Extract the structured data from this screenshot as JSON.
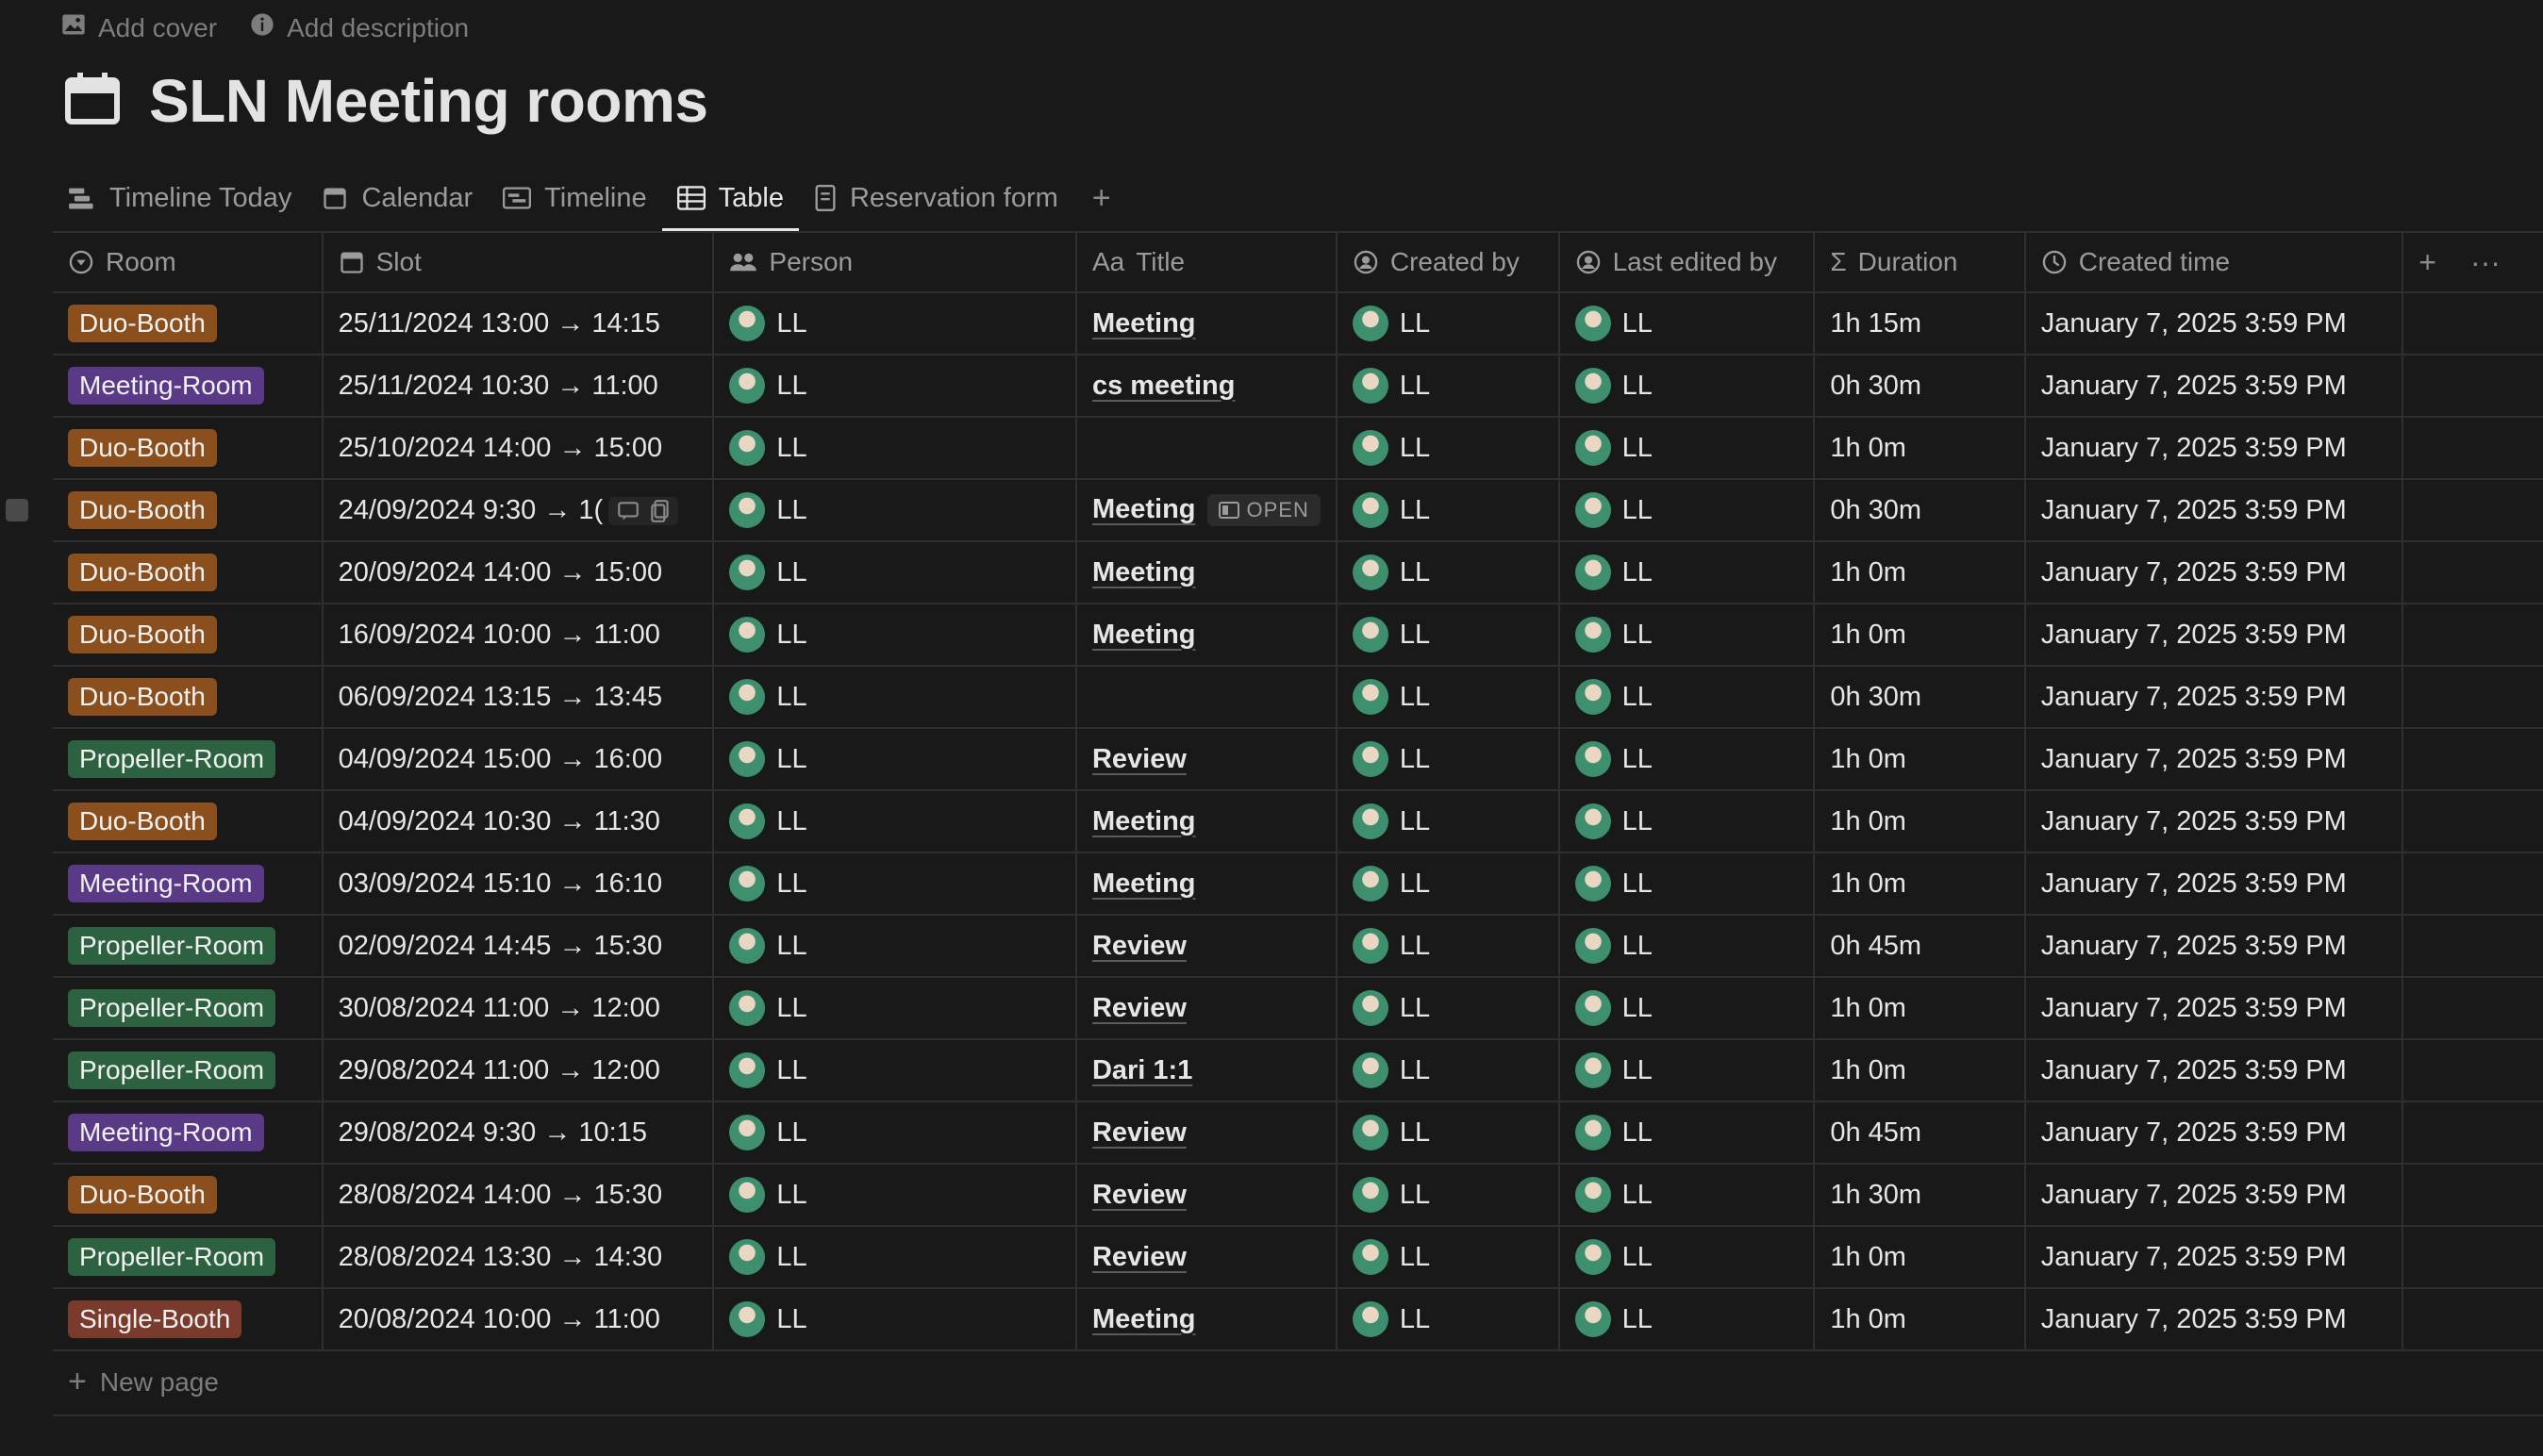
{
  "top_actions": {
    "add_cover": "Add cover",
    "add_description": "Add description"
  },
  "page_title": "SLN Meeting rooms",
  "tabs": [
    {
      "label": "Timeline Today",
      "icon": "timeline-today-icon",
      "active": false
    },
    {
      "label": "Calendar",
      "icon": "calendar-icon",
      "active": false
    },
    {
      "label": "Timeline",
      "icon": "timeline-icon",
      "active": false
    },
    {
      "label": "Table",
      "icon": "table-icon",
      "active": true
    },
    {
      "label": "Reservation form",
      "icon": "form-icon",
      "active": false
    }
  ],
  "columns": {
    "room": "Room",
    "slot": "Slot",
    "person": "Person",
    "title": "Title",
    "created_by": "Created by",
    "last_edited_by": "Last edited by",
    "duration": "Duration",
    "created_time": "Created time",
    "title_prefix": "Aa"
  },
  "room_colors": {
    "Duo-Booth": "#8a4f1c",
    "Meeting-Room": "#5a3a87",
    "Propeller-Room": "#2d6240",
    "Single-Booth": "#7a3a2c"
  },
  "rows": [
    {
      "room": "Duo-Booth",
      "slot": "25/11/2024 13:00 → 14:15",
      "person": "LL",
      "title": "Meeting",
      "created_by": "LL",
      "last_edited_by": "LL",
      "duration": "1h 15m",
      "created_time": "January 7, 2025 3:59 PM"
    },
    {
      "room": "Meeting-Room",
      "slot": "25/11/2024 10:30 → 11:00",
      "person": "LL",
      "title": "cs meeting",
      "created_by": "LL",
      "last_edited_by": "LL",
      "duration": "0h 30m",
      "created_time": "January 7, 2025 3:59 PM"
    },
    {
      "room": "Duo-Booth",
      "slot": "25/10/2024 14:00 → 15:00",
      "person": "LL",
      "title": "",
      "created_by": "LL",
      "last_edited_by": "LL",
      "duration": "1h 0m",
      "created_time": "January 7, 2025 3:59 PM"
    },
    {
      "room": "Duo-Booth",
      "slot": "24/09/2024 9:30 → 1(",
      "person": "LL",
      "title": "Meeting",
      "created_by": "LL",
      "last_edited_by": "LL",
      "duration": "0h 30m",
      "created_time": "January 7, 2025 3:59 PM",
      "hover": true,
      "open_label": "OPEN"
    },
    {
      "room": "Duo-Booth",
      "slot": "20/09/2024 14:00 → 15:00",
      "person": "LL",
      "title": "Meeting",
      "created_by": "LL",
      "last_edited_by": "LL",
      "duration": "1h 0m",
      "created_time": "January 7, 2025 3:59 PM"
    },
    {
      "room": "Duo-Booth",
      "slot": "16/09/2024 10:00 → 11:00",
      "person": "LL",
      "title": "Meeting",
      "created_by": "LL",
      "last_edited_by": "LL",
      "duration": "1h 0m",
      "created_time": "January 7, 2025 3:59 PM"
    },
    {
      "room": "Duo-Booth",
      "slot": "06/09/2024 13:15 → 13:45",
      "person": "LL",
      "title": "",
      "created_by": "LL",
      "last_edited_by": "LL",
      "duration": "0h 30m",
      "created_time": "January 7, 2025 3:59 PM"
    },
    {
      "room": "Propeller-Room",
      "slot": "04/09/2024 15:00 → 16:00",
      "person": "LL",
      "title": "Review",
      "created_by": "LL",
      "last_edited_by": "LL",
      "duration": "1h 0m",
      "created_time": "January 7, 2025 3:59 PM"
    },
    {
      "room": "Duo-Booth",
      "slot": "04/09/2024 10:30 → 11:30",
      "person": "LL",
      "title": "Meeting",
      "created_by": "LL",
      "last_edited_by": "LL",
      "duration": "1h 0m",
      "created_time": "January 7, 2025 3:59 PM"
    },
    {
      "room": "Meeting-Room",
      "slot": "03/09/2024 15:10 → 16:10",
      "person": "LL",
      "title": "Meeting",
      "created_by": "LL",
      "last_edited_by": "LL",
      "duration": "1h 0m",
      "created_time": "January 7, 2025 3:59 PM"
    },
    {
      "room": "Propeller-Room",
      "slot": "02/09/2024 14:45 → 15:30",
      "person": "LL",
      "title": "Review",
      "created_by": "LL",
      "last_edited_by": "LL",
      "duration": "0h 45m",
      "created_time": "January 7, 2025 3:59 PM"
    },
    {
      "room": "Propeller-Room",
      "slot": "30/08/2024 11:00 → 12:00",
      "person": "LL",
      "title": "Review",
      "created_by": "LL",
      "last_edited_by": "LL",
      "duration": "1h 0m",
      "created_time": "January 7, 2025 3:59 PM"
    },
    {
      "room": "Propeller-Room",
      "slot": "29/08/2024 11:00 → 12:00",
      "person": "LL",
      "title": "Dari 1:1",
      "created_by": "LL",
      "last_edited_by": "LL",
      "duration": "1h 0m",
      "created_time": "January 7, 2025 3:59 PM"
    },
    {
      "room": "Meeting-Room",
      "slot": "29/08/2024 9:30 → 10:15",
      "person": "LL",
      "title": "Review",
      "created_by": "LL",
      "last_edited_by": "LL",
      "duration": "0h 45m",
      "created_time": "January 7, 2025 3:59 PM"
    },
    {
      "room": "Duo-Booth",
      "slot": "28/08/2024 14:00 → 15:30",
      "person": "LL",
      "title": "Review",
      "created_by": "LL",
      "last_edited_by": "LL",
      "duration": "1h 30m",
      "created_time": "January 7, 2025 3:59 PM"
    },
    {
      "room": "Propeller-Room",
      "slot": "28/08/2024 13:30 → 14:30",
      "person": "LL",
      "title": "Review",
      "created_by": "LL",
      "last_edited_by": "LL",
      "duration": "1h 0m",
      "created_time": "January 7, 2025 3:59 PM"
    },
    {
      "room": "Single-Booth",
      "slot": "20/08/2024 10:00 → 11:00",
      "person": "LL",
      "title": "Meeting",
      "created_by": "LL",
      "last_edited_by": "LL",
      "duration": "1h 0m",
      "created_time": "January 7, 2025 3:59 PM"
    }
  ],
  "new_page": "New page"
}
